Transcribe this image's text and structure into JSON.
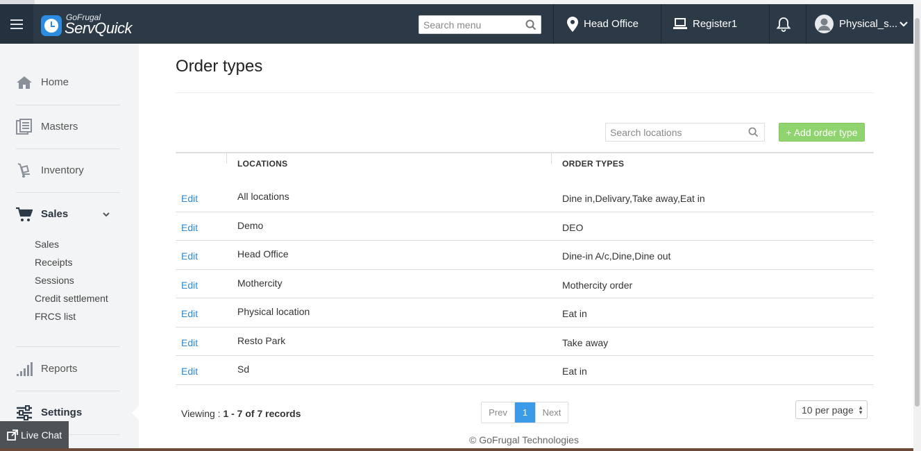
{
  "brand": {
    "top": "GoFrugal",
    "main": "ServQuick"
  },
  "header": {
    "search_placeholder": "Search menu",
    "location": "Head Office",
    "register": "Register1",
    "user": "Physical_s..."
  },
  "sidebar": {
    "items": [
      {
        "label": "Home",
        "icon": "home-icon"
      },
      {
        "label": "Masters",
        "icon": "masters-icon"
      },
      {
        "label": "Inventory",
        "icon": "inventory-icon"
      },
      {
        "label": "Sales",
        "icon": "cart-icon"
      },
      {
        "label": "Reports",
        "icon": "reports-icon"
      },
      {
        "label": "Settings",
        "icon": "settings-icon"
      }
    ],
    "sales_sub": [
      "Sales",
      "Receipts",
      "Sessions",
      "Credit settlement",
      "FRCS list"
    ]
  },
  "live_chat": "Live Chat",
  "page": {
    "title": "Order types",
    "search_placeholder": "Search locations",
    "add_button": "+ Add order type"
  },
  "table": {
    "columns": [
      "LOCATIONS",
      "ORDER TYPES"
    ],
    "edit_label": "Edit",
    "rows": [
      {
        "location": "All locations",
        "order_types": "Dine in,Delivary,Take away,Eat in"
      },
      {
        "location": "Demo",
        "order_types": "DEO"
      },
      {
        "location": "Head Office",
        "order_types": "Dine-in A/c,Dine,Dine out"
      },
      {
        "location": "Mothercity",
        "order_types": "Mothercity order"
      },
      {
        "location": "Physical location",
        "order_types": "Eat in"
      },
      {
        "location": "Resto Park",
        "order_types": "Take away"
      },
      {
        "location": "Sd",
        "order_types": "Eat in"
      }
    ]
  },
  "pagination": {
    "viewing_prefix": "Viewing : ",
    "viewing_range": "1 - 7 of 7 records",
    "prev": "Prev",
    "current": "1",
    "next": "Next",
    "per_page": "10 per page"
  },
  "footer": "© GoFrugal Technologies",
  "colors": {
    "header": "#2c3a47",
    "accent": "#3c9be8",
    "add_button": "#8fd46e",
    "link": "#2a8ad6"
  }
}
